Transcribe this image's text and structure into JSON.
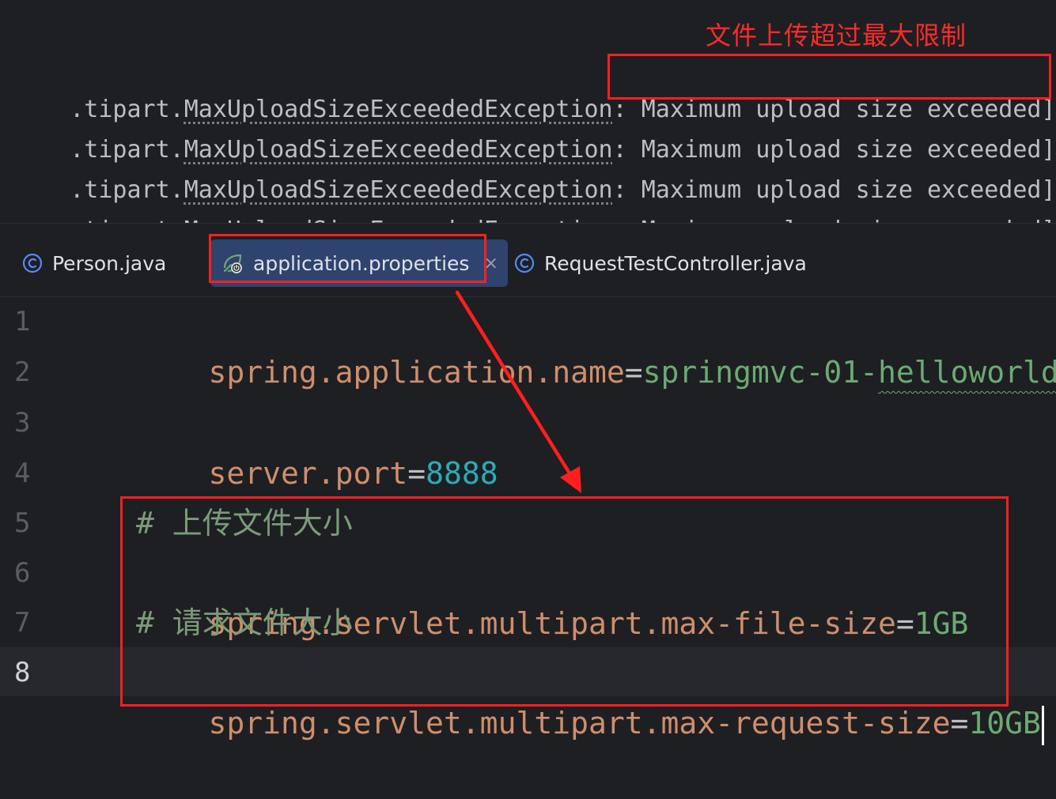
{
  "console": {
    "fragment": "'··'",
    "annotation": "文件上传超过最大限制",
    "lines": [
      {
        "prefix": ".tipart.",
        "exception": "MaxUploadSizeExceededException",
        "sep": ": ",
        "message": "Maximum upload size exceeded]"
      },
      {
        "prefix": ".tipart.",
        "exception": "MaxUploadSizeExceededException",
        "sep": ": ",
        "message": "Maximum upload size exceeded]"
      },
      {
        "prefix": ".tipart.",
        "exception": "MaxUploadSizeExceededException",
        "sep": ": ",
        "message": "Maximum upload size exceeded]"
      },
      {
        "prefix": ".tipart.",
        "exception": "MaxUploadSizeExceededException",
        "sep": ": ",
        "message": "Maximum upload size exceeded]"
      }
    ]
  },
  "tabs": [
    {
      "label": "Person.java",
      "icon": "java-class-icon",
      "active": false
    },
    {
      "label": "application.properties",
      "icon": "spring-properties-icon",
      "active": true,
      "close": "×"
    },
    {
      "label": "RequestTestController.java",
      "icon": "java-class-icon",
      "active": false
    }
  ],
  "editor": {
    "line_numbers": [
      "1",
      "2",
      "3",
      "4",
      "5",
      "6",
      "7",
      "8"
    ],
    "current_line": "8",
    "lines": {
      "l1": {
        "key": "spring.application.name",
        "eq": "=",
        "value_a": "springmvc-01-",
        "value_b": "helloworld"
      },
      "l3": {
        "key": "server.port",
        "eq": "=",
        "value": "8888"
      },
      "l5": {
        "comment": "# 上传文件大小"
      },
      "l6": {
        "key": "spring.servlet.multipart.max-file-size",
        "eq": "=",
        "value": "1GB"
      },
      "l7": {
        "comment": "# 请求文件大小"
      },
      "l8": {
        "key": "spring.servlet.multipart.max-request-size",
        "eq": "=",
        "value": "10GB"
      }
    }
  },
  "colors": {
    "annotation_red": "#ff1f1f",
    "background": "#1e1f22",
    "key_orange": "#cf8e6d",
    "value_green": "#6aab73",
    "number_cyan": "#2aacb8",
    "comment_green": "#7a9c79",
    "active_tab": "#2e436e"
  }
}
